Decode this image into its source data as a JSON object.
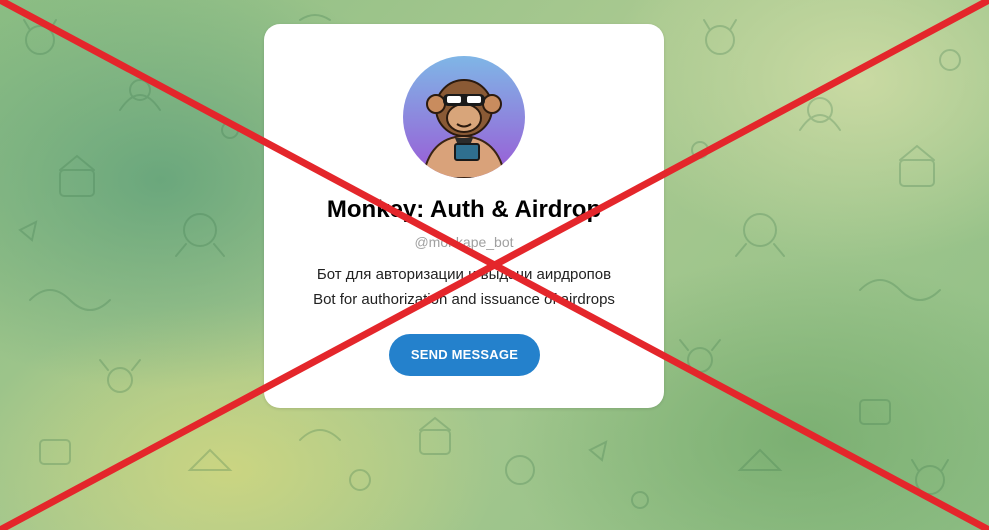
{
  "bot": {
    "name": "Monkey: Auth & Airdrop",
    "username": "@monkape_bot",
    "description_ru": "Бот для авторизации и выдачи аирдропов",
    "description_en": "Bot for authorization and issuance of airdrops",
    "avatar_icon": "monkey-avatar"
  },
  "actions": {
    "send_message_label": "SEND MESSAGE"
  },
  "overlay": {
    "type": "red-cross",
    "color": "#e4262b"
  },
  "colors": {
    "button": "#2481cc",
    "card": "#ffffff",
    "background": "#9cc48b"
  }
}
